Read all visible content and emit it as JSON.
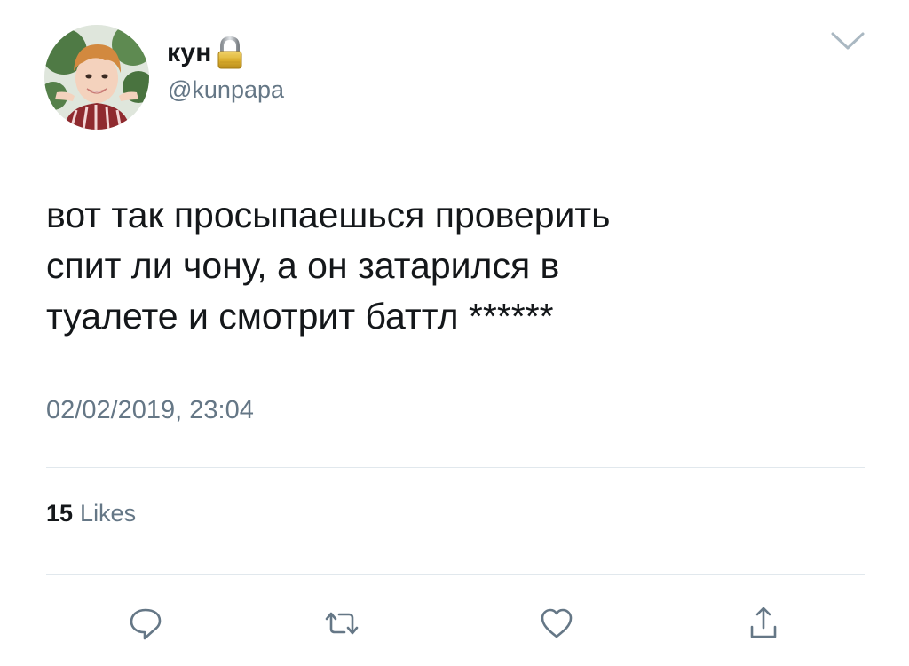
{
  "tweet": {
    "author": {
      "display_name": "кун",
      "handle": "@kunpapa",
      "protected_icon": "lock-icon",
      "avatar": "avatar-photo"
    },
    "text": "вот так просыпаешься проверить\nспит ли чону, а он затарился в\nтуалете и смотрит баттл ******",
    "timestamp": "02/02/2019, 23:04",
    "stats": {
      "likes_count": "15",
      "likes_label": "Likes"
    },
    "actions": [
      {
        "name": "reply",
        "icon": "speech-bubble-icon"
      },
      {
        "name": "retweet",
        "icon": "retweet-icon"
      },
      {
        "name": "like",
        "icon": "heart-icon"
      },
      {
        "name": "share",
        "icon": "share-icon"
      }
    ],
    "menu_icon": "chevron-down-icon"
  },
  "colors": {
    "text_primary": "#14171a",
    "text_secondary": "#657786",
    "divider": "#e1e8ed",
    "icon": "#657786"
  }
}
